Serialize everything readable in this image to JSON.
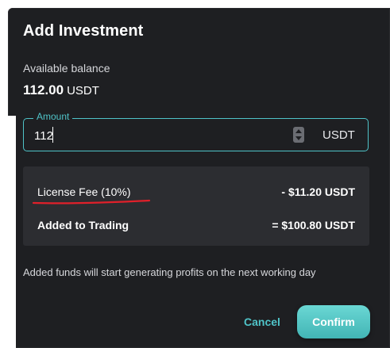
{
  "dialog": {
    "title": "Add Investment"
  },
  "balance": {
    "label": "Available balance",
    "amount": "112.00",
    "unit": "USDT"
  },
  "amount_field": {
    "legend": "Amount",
    "value": "112",
    "unit": "USDT"
  },
  "summary": {
    "fee_label": "License Fee (10%)",
    "fee_value": "- $11.20 USDT",
    "trading_label": "Added to Trading",
    "trading_value": "= $100.80 USDT"
  },
  "note": "Added funds will start generating profits on the next working day",
  "actions": {
    "cancel_label": "Cancel",
    "confirm_label": "Confirm"
  },
  "colors": {
    "accent": "#4fc3c8",
    "surface": "#1e1f22",
    "summary_bg": "#2c2d31",
    "annotation": "#e0202a"
  },
  "icons": {
    "stepper": "spinner-arrows-icon"
  }
}
